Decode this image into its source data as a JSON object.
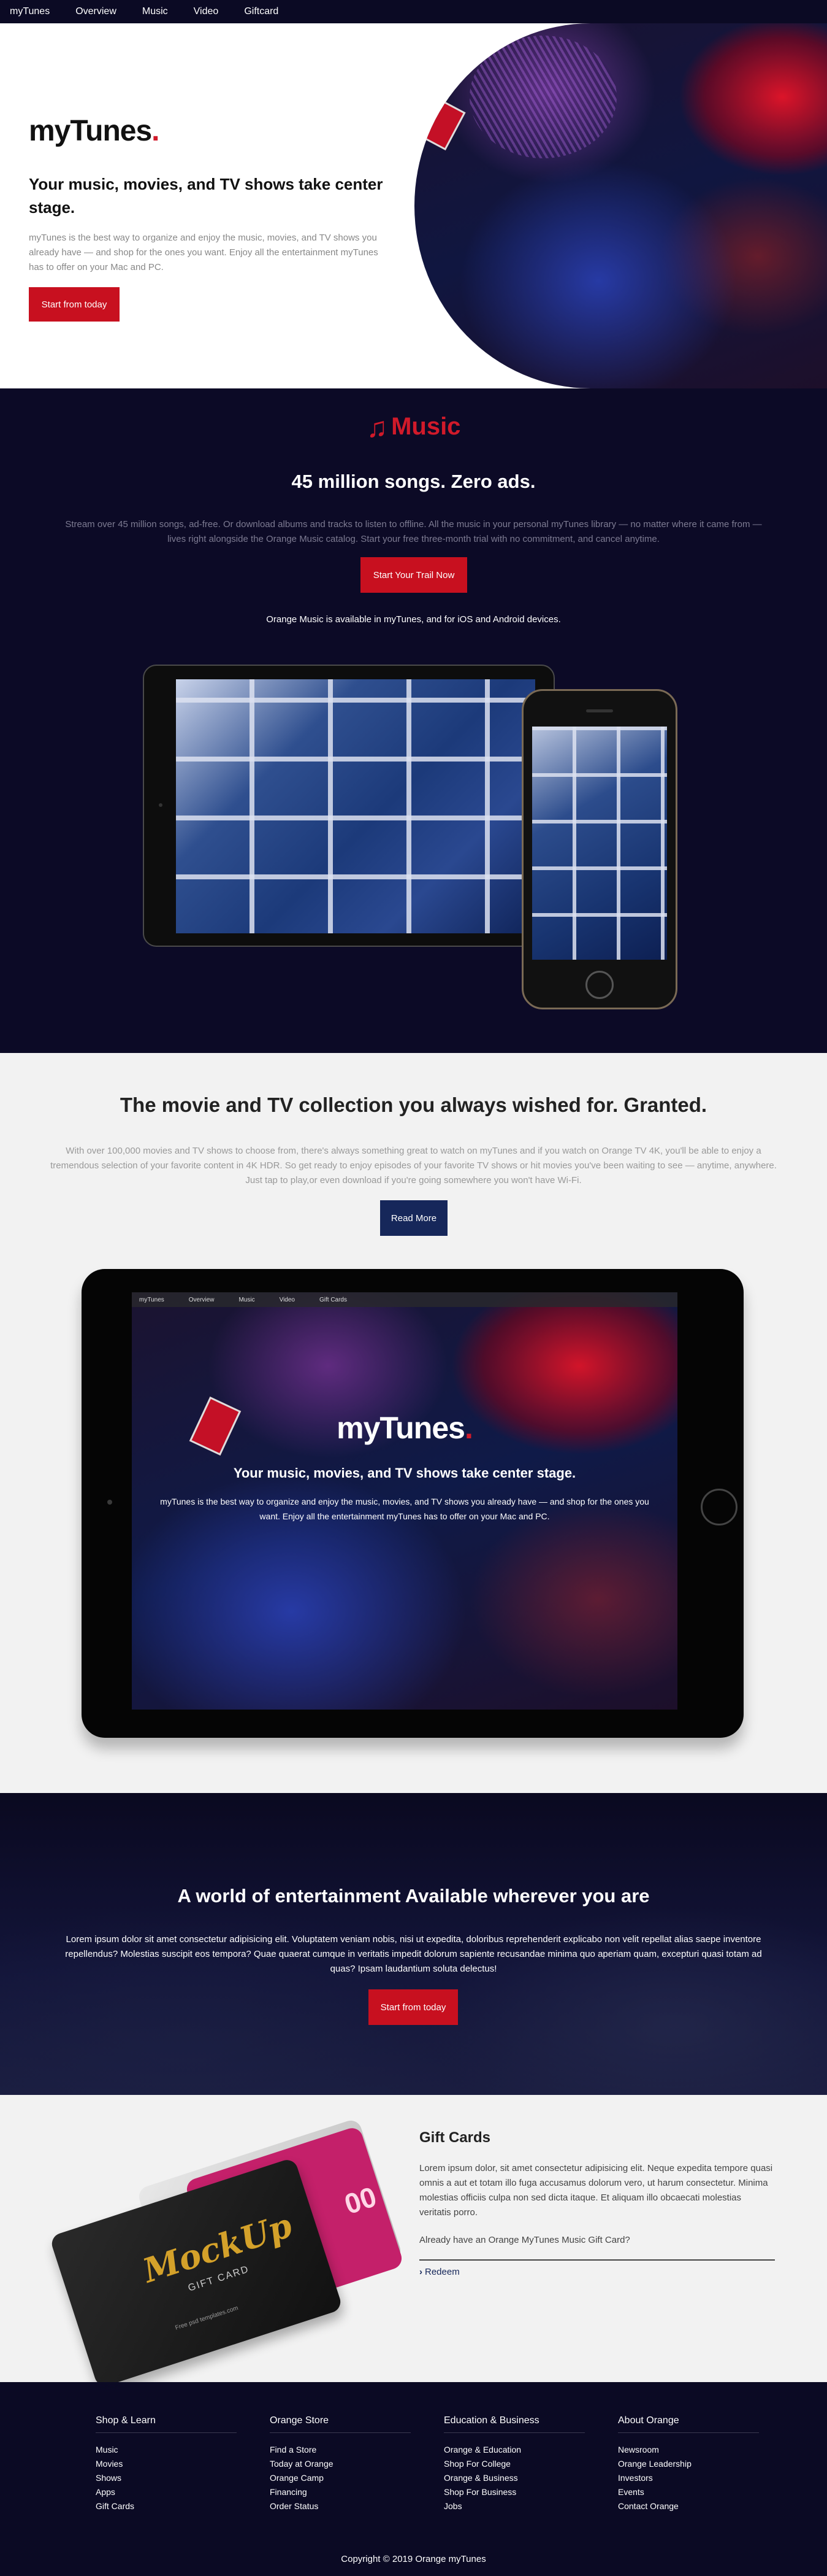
{
  "nav": {
    "items": [
      "myTunes",
      "Overview",
      "Music",
      "Video",
      "Giftcard"
    ]
  },
  "hero": {
    "brand": "myTunes",
    "brand_dot": ".",
    "tagline": "Your music, movies, and TV shows take center stage.",
    "description": "myTunes is the best way to organize and enjoy the music, movies, and TV shows you already have — and shop for the ones you want. Enjoy all the entertainment myTunes has to offer on your Mac and PC.",
    "button": "Start from today"
  },
  "music": {
    "logo_icon": "music-note-icon",
    "logo_text": "Music",
    "heading": "45 million songs. Zero ads.",
    "description": "Stream over 45 million songs, ad-free. Or download albums and tracks to listen to offline. All the music in your personal myTunes library — no matter where it came from — lives right alongside the Orange Music catalog. Start your free three-month trial with no commitment, and cancel anytime.",
    "button": "Start Your Trail Now",
    "availability": "Orange Music is available in myTunes, and for iOS and Android devices."
  },
  "movies": {
    "heading": "The movie and TV collection you always wished for. Granted.",
    "description": "With over 100,000 movies and TV shows to choose from, there's always something great to watch on myTunes and if you watch on Orange TV 4K, you'll be able to enjoy a tremendous selection of your favorite content in 4K HDR. So get ready to enjoy episodes of your favorite TV shows or hit movies you've been waiting to see — anytime, anywhere. Just tap to play,or even download if you're going somewhere you won't have Wi-Fi.",
    "button": "Read More",
    "ipad": {
      "nav": [
        "myTunes",
        "Overview",
        "Music",
        "Video",
        "Gift Cards"
      ],
      "brand": "myTunes",
      "brand_dot": ".",
      "tagline": "Your music, movies, and TV shows take center stage.",
      "description": "myTunes is the best way to organize and enjoy the music, movies, and TV shows you already have — and shop for the ones you want. Enjoy all the entertainment myTunes has to offer on your Mac and PC."
    }
  },
  "world": {
    "heading": "A world of entertainment Available wherever you are",
    "description": "Lorem ipsum dolor sit amet consectetur adipisicing elit. Voluptatem veniam nobis, nisi ut expedita, doloribus reprehenderit explicabo non velit repellat alias saepe inventore repellendus? Molestias suscipit eos tempora? Quae quaerat cumque in veritatis impedit dolorum sapiente recusandae minima quo aperiam quam, excepturi quasi totam ad quas? Ipsam laudantium soluta delectus!",
    "button": "Start from today"
  },
  "gift": {
    "title": "Gift Cards",
    "description": "Lorem ipsum dolor, sit amet consectetur adipisicing elit. Neque expedita tempore quasi omnis a aut et totam illo fuga accusamus dolorum vero, ut harum consectetur. Minima molestias officiis culpa non sed dicta itaque. Et aliquam illo obcaecati molestias veritatis porro.",
    "question": "Already have an Orange MyTunes Music Gift Card?",
    "redeem": "Redeem",
    "card": {
      "title": "MockUp",
      "subtitle": "GIFT CARD",
      "small": "Free psd templates.com",
      "back_label": "00"
    }
  },
  "footer": {
    "columns": [
      {
        "title": "Shop & Learn",
        "links": [
          "Music",
          "Movies",
          "Shows",
          "Apps",
          "Gift Cards"
        ]
      },
      {
        "title": "Orange Store",
        "links": [
          "Find a Store",
          "Today at Orange",
          "Orange Camp",
          "Financing",
          "Order Status"
        ]
      },
      {
        "title": "Education & Business",
        "links": [
          "Orange & Education",
          "Shop For College",
          "Orange & Business",
          "Shop For Business",
          "Jobs"
        ]
      },
      {
        "title": "About Orange",
        "links": [
          "Newsroom",
          "Orange Leadership",
          "Investors",
          "Events",
          "Contact Orange"
        ]
      }
    ],
    "copyright": "Copyright © 2019 Orange myTunes"
  },
  "colors": {
    "accent_red": "#c8101f",
    "navy_button": "#16275a",
    "dark_bg": "#0b0a24"
  }
}
